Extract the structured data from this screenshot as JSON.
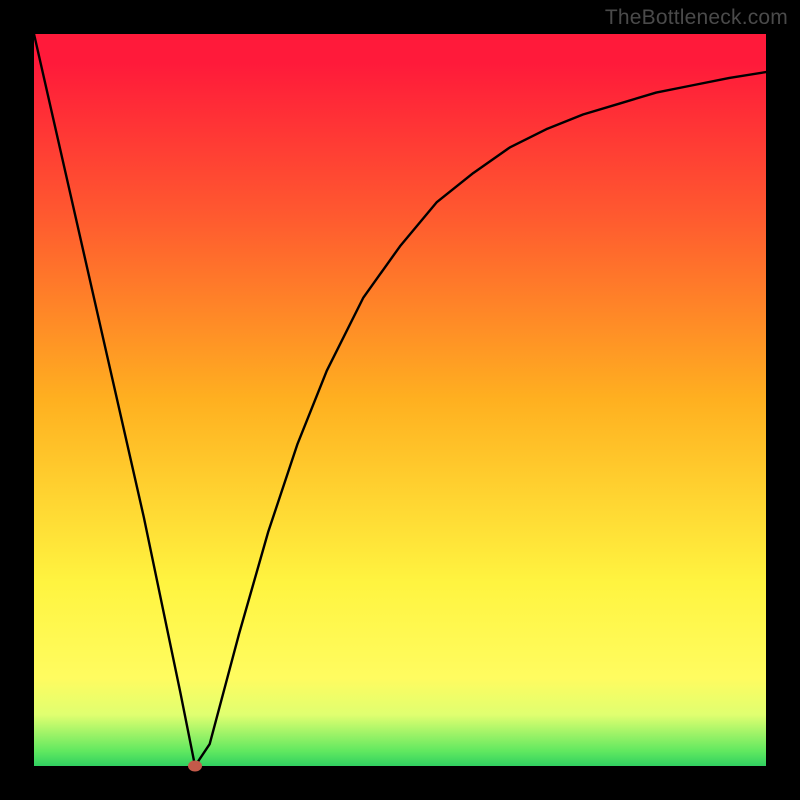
{
  "watermark": "TheBottleneck.com",
  "chart_data": {
    "type": "line",
    "title": "",
    "xlabel": "",
    "ylabel": "",
    "xlim": [
      0,
      100
    ],
    "ylim": [
      0,
      100
    ],
    "series": [
      {
        "name": "curve",
        "x": [
          0,
          5,
          10,
          15,
          20,
          22,
          24,
          28,
          32,
          36,
          40,
          45,
          50,
          55,
          60,
          65,
          70,
          75,
          80,
          85,
          90,
          95,
          100
        ],
        "values": [
          100,
          78,
          56,
          34,
          10,
          0,
          3,
          18,
          32,
          44,
          54,
          64,
          71,
          77,
          81,
          84.5,
          87,
          89,
          90.5,
          92,
          93,
          94,
          94.8
        ]
      }
    ],
    "marker": {
      "x": 22,
      "y": 0,
      "color": "#c45a4a"
    },
    "background_gradient": {
      "top": "#ff1a3a",
      "middle": "#fff440",
      "bottom": "#30d060"
    }
  }
}
